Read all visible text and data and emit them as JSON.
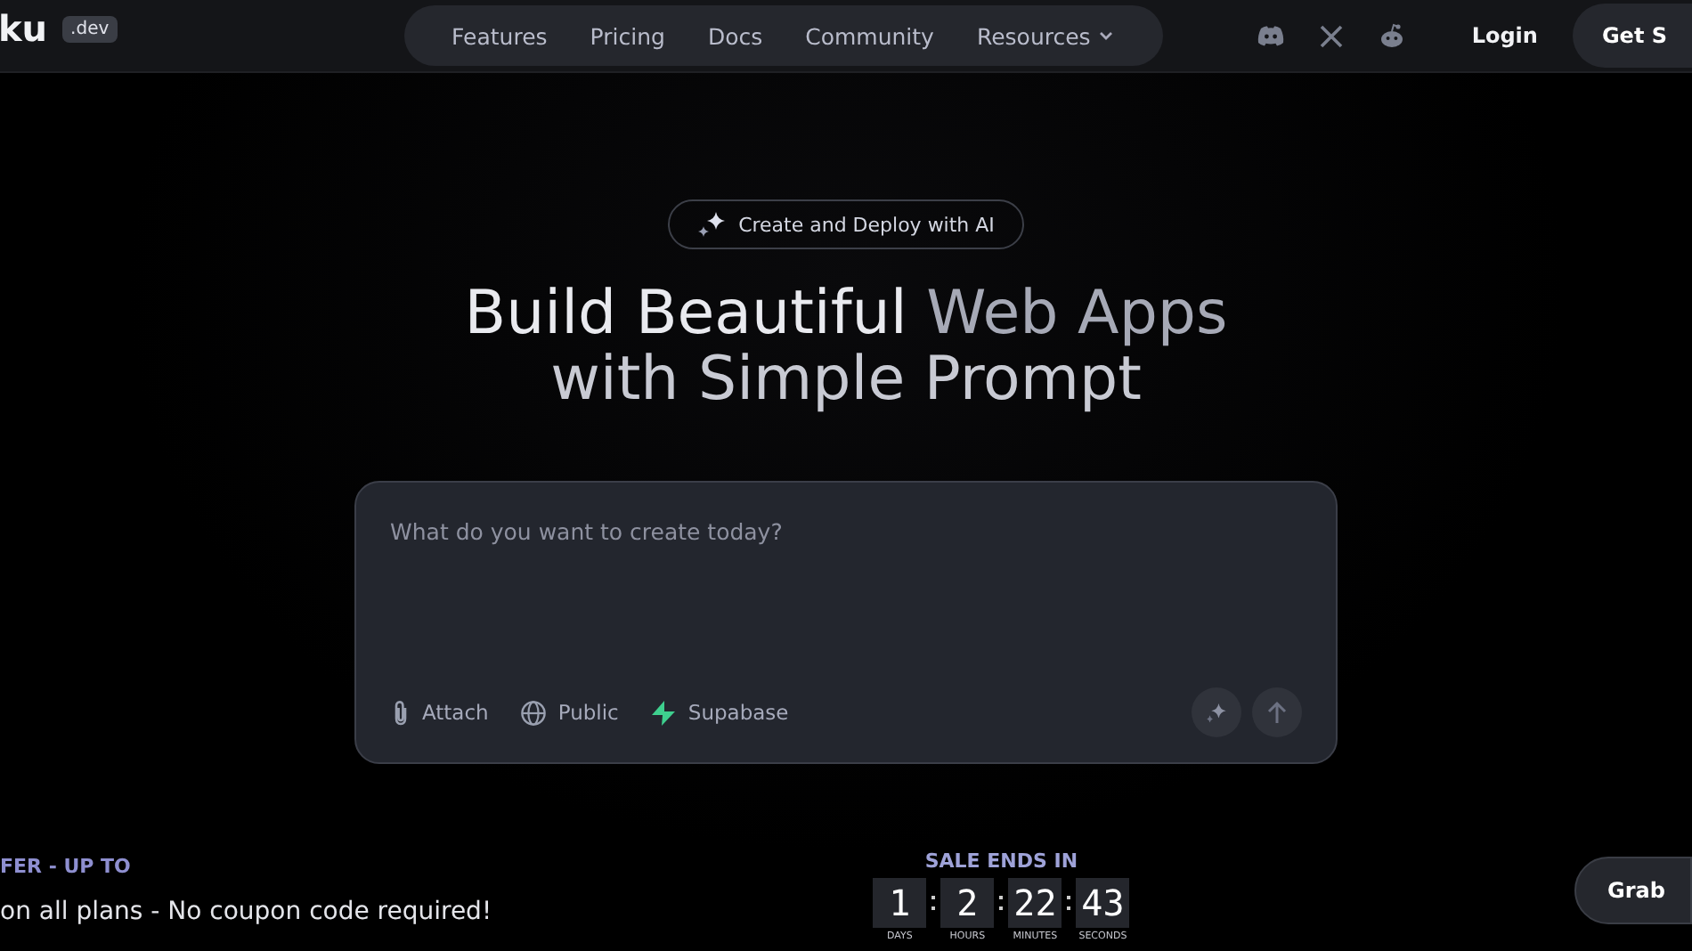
{
  "header": {
    "logo": "ku",
    "logo_badge": ".dev",
    "nav": [
      {
        "label": "Features",
        "has_caret": false
      },
      {
        "label": "Pricing",
        "has_caret": false
      },
      {
        "label": "Docs",
        "has_caret": false
      },
      {
        "label": "Community",
        "has_caret": false
      },
      {
        "label": "Resources",
        "has_caret": true
      }
    ],
    "login": "Login",
    "cta": "Get S"
  },
  "hero": {
    "badge": "Create and Deploy with AI",
    "title_lines": [
      [
        {
          "text": "Build Beautiful",
          "muted": false
        },
        {
          "text": "Web Apps",
          "muted": true
        }
      ],
      [
        {
          "text": "with Simple Prompt",
          "muted": false
        }
      ]
    ]
  },
  "prompt": {
    "placeholder": "What do you want to create today?",
    "tools": [
      {
        "kind": "attach",
        "label": "Attach"
      },
      {
        "kind": "globe",
        "label": "Public"
      },
      {
        "kind": "bolt",
        "label": "Supabase"
      }
    ]
  },
  "promo": {
    "offer": "FER - UP TO",
    "note": "on all plans - No coupon code required!",
    "sale_title": "SALE ENDS IN",
    "countdown": [
      {
        "value": "1",
        "unit": "DAYS"
      },
      {
        "value": "2",
        "unit": "HOURS"
      },
      {
        "value": "22",
        "unit": "MINUTES"
      },
      {
        "value": "43",
        "unit": "SECONDS"
      }
    ],
    "grab": "Grab"
  }
}
